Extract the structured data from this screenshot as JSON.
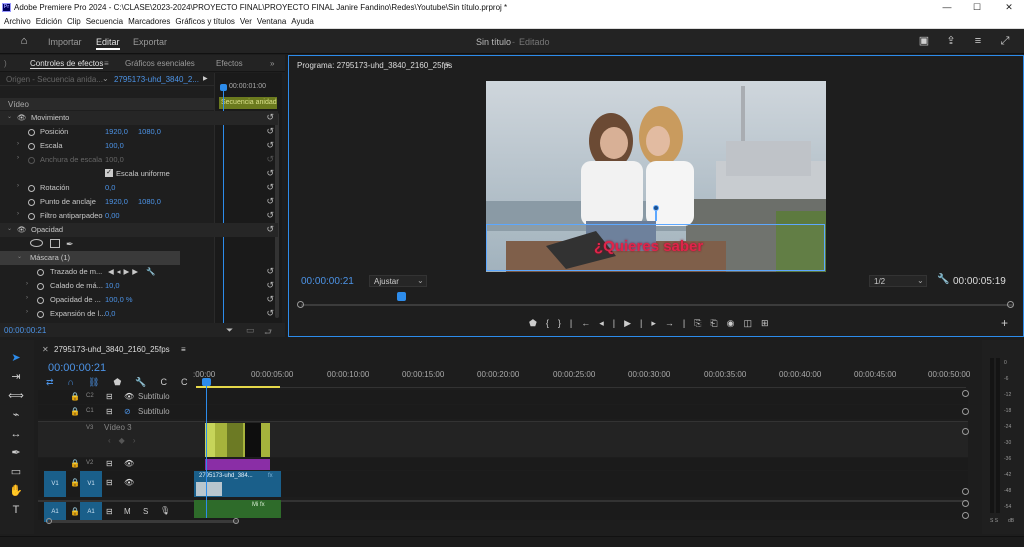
{
  "window": {
    "title": "Adobe Premiere Pro 2024 - C:\\CLASE\\2023-2024\\PROYECTO FINAL\\PROYECTO FINAL Janire Fandino\\Redes\\Youtube\\Sin título.prproj *",
    "app_icon": "Pr",
    "minimize": "—",
    "maximize": "☐",
    "close": "✕"
  },
  "menu": [
    "Archivo",
    "Edición",
    "Clip",
    "Secuencia",
    "Marcadores",
    "Gráficos y títulos",
    "Ver",
    "Ventana",
    "Ayuda"
  ],
  "header": {
    "tabs": [
      "Importar",
      "Editar",
      "Exportar"
    ],
    "active_tab": "Editar",
    "project_name": "Sin título",
    "project_status": "Editado"
  },
  "effects_panel": {
    "tabs": [
      "Controles de efectos",
      "Gráficos esenciales",
      "Efectos"
    ],
    "source_label": "Origen - Secuencia anida...",
    "clip_label": "2795173-uhd_3840_2...",
    "timecode_head": "00:00:01:00",
    "nested_seq": "Secuencia anidad",
    "section_video": "Vídeo",
    "rows": [
      {
        "label": "Movimiento"
      },
      {
        "label": "Posición",
        "v1": "1920,0",
        "v2": "1080,0"
      },
      {
        "label": "Escala",
        "v1": "100,0"
      },
      {
        "label": "Anchura de escala",
        "v1": "100,0"
      },
      {
        "label": "Escala uniforme"
      },
      {
        "label": "Rotación",
        "v1": "0,0"
      },
      {
        "label": "Punto de anclaje",
        "v1": "1920,0",
        "v2": "1080,0"
      },
      {
        "label": "Filtro antiparpadeo",
        "v1": "0,00"
      },
      {
        "label": "Opacidad"
      },
      {
        "label": "Máscara (1)"
      },
      {
        "label": "Trazado de m..."
      },
      {
        "label": "Calado de má...",
        "v1": "10,0"
      },
      {
        "label": "Opacidad de ...",
        "v1": "100,0 %"
      },
      {
        "label": "Expansión de l...",
        "v1": "0,0"
      }
    ],
    "footer_timecode": "00:00:00:21"
  },
  "program_monitor": {
    "title": "Programa: 2795173-uhd_3840_2160_25fps",
    "overlay_text": "¿Quieres saber",
    "timecode": "00:00:00:21",
    "fit": "Ajustar",
    "resolution": "1/2",
    "duration": "00:00:05:19"
  },
  "timeline": {
    "sequence_name": "2795173-uhd_3840_2160_25fps",
    "timecode": "00:00:00:21",
    "ruler": [
      ":00:00",
      "00:00:05:00",
      "00:00:10:00",
      "00:00:15:00",
      "00:00:20:00",
      "00:00:25:00",
      "00:00:30:00",
      "00:00:35:00",
      "00:00:40:00",
      "00:00:45:00",
      "00:00:50:00"
    ],
    "tracks": {
      "c2": "C2",
      "c1": "C1",
      "c2_label": "Subtítulo",
      "c1_label": "Subtítulo",
      "v3": "V3",
      "v3_label": "Vídeo 3",
      "v2": "V2",
      "v1": "V1",
      "a1": "A1",
      "m": "M",
      "s": "S"
    },
    "clip_v1": "2795173-uhd_384...",
    "fx": "fx",
    "clip_a1": "Mi fx"
  },
  "meter": {
    "scale": [
      "0",
      "-6",
      "-12",
      "-18",
      "-24",
      "-30",
      "-36",
      "-42",
      "-48",
      "-54",
      "dB"
    ],
    "footer": "S S"
  },
  "colors": {
    "accent": "#2d8ceb",
    "timecode": "#4c93e6",
    "audio_clip": "#2e6b2a",
    "video_clip": "#1a5f8a",
    "nested_clip": "#a6b33c",
    "purple_clip": "#8a2ea6",
    "text_overlay": "#e0244a"
  }
}
